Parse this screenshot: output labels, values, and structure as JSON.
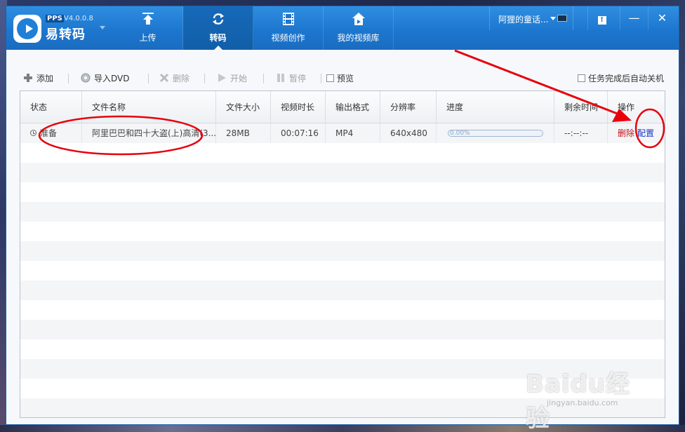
{
  "app": {
    "brand_tag": "PPS",
    "version": "V4.0.0.8",
    "name": "易转码"
  },
  "nav": {
    "tabs": [
      {
        "label": "上传",
        "icon": "upload-icon"
      },
      {
        "label": "转码",
        "icon": "transcode-icon",
        "active": true
      },
      {
        "label": "视频创作",
        "icon": "film-icon"
      },
      {
        "label": "我的视频库",
        "icon": "home-library-icon"
      }
    ]
  },
  "user": {
    "name": "阿狸的童话..."
  },
  "window_controls": {
    "feedback": "!",
    "minimize": "—",
    "close": "✕"
  },
  "toolbar": {
    "add": "添加",
    "import_dvd": "导入DVD",
    "delete": "删除",
    "start": "开始",
    "pause": "暂停",
    "preview": "预览",
    "auto_shutdown": "任务完成后自动关机"
  },
  "table": {
    "columns": [
      "状态",
      "文件名称",
      "文件大小",
      "视频时长",
      "输出格式",
      "分辨率",
      "进度",
      "剩余时间",
      "操作"
    ],
    "rows": [
      {
        "status": "准备",
        "filename": "阿里巴巴和四十大盗(上)高清(3...",
        "size": "28MB",
        "duration": "00:07:16",
        "format": "MP4",
        "resolution": "640x480",
        "progress_text": "0.00%",
        "progress": 0,
        "remaining": "--:--:--",
        "op_delete": "删除",
        "op_config": "配置"
      }
    ]
  },
  "watermark": {
    "brand": "Baidu经验",
    "url": "jingyan.baidu.com"
  },
  "colors": {
    "titlebar": "#1d77cf",
    "active_tab": "#115ea8",
    "delete_link": "#c0141b",
    "config_link": "#1733c5",
    "annotation": "#e8000b"
  }
}
